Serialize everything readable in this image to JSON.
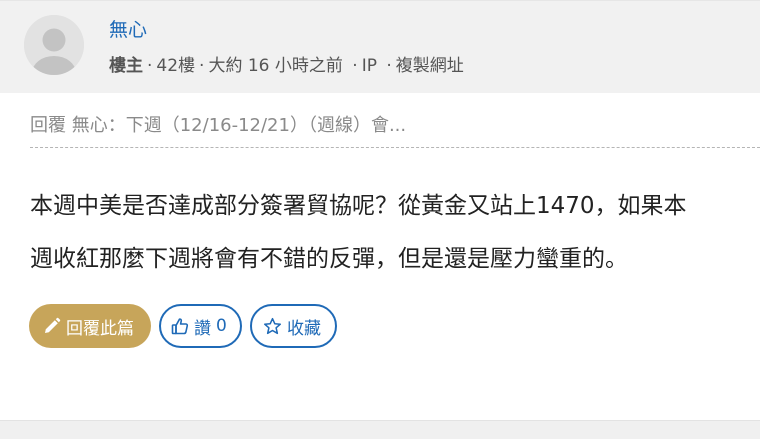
{
  "post": {
    "author": "無心",
    "role": "樓主",
    "floor": "42樓",
    "time": "大約 16 小時之前",
    "ip_label": "IP",
    "copy_link_label": "複製網址",
    "quote": "回覆 無心：下週（12/16-12/21）（週線）會...",
    "body_lines": [
      "本週中美是否達成部分簽署貿協呢？從黃金又站上1470，如果本",
      "週收紅那麼下週將會有不錯的反彈，但是還是壓力蠻重的。"
    ]
  },
  "actions": {
    "reply_label": "回覆此篇",
    "like_label": "讚",
    "like_count": "0",
    "favorite_label": "收藏"
  },
  "icons": {
    "avatar": "default-user-avatar",
    "reply": "pencil-icon",
    "like": "thumbs-up-icon",
    "favorite": "star-icon"
  },
  "colors": {
    "link_blue": "#1f6ab7",
    "reply_gold": "#c7a55a",
    "header_bg": "#f1f1f1"
  }
}
